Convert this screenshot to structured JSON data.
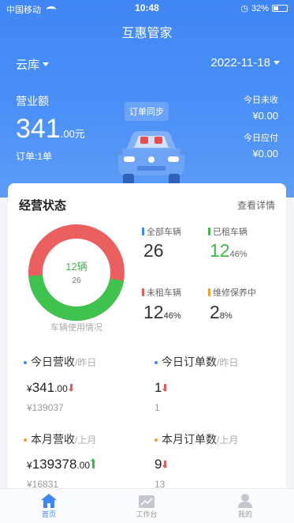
{
  "status_bar": {
    "carrier": "中国移动",
    "time": "10:48",
    "battery": "32%"
  },
  "header": {
    "title": "互惠管家",
    "store": "云库",
    "date": "2022-11-18"
  },
  "revenue": {
    "label": "营业额",
    "value_int": "341",
    "value_dec": ".00元",
    "orders": "订单:1单",
    "sync_button": "订单同步",
    "today_receivable_label": "今日未收",
    "today_receivable_value": "¥0.00",
    "today_payable_label": "今日应付",
    "today_payable_value": "¥0.00"
  },
  "operation": {
    "title": "经营状态",
    "detail_link": "查看详情",
    "donut": {
      "main_text": "12辆",
      "sub_text": "26",
      "caption": "车辆使用情况",
      "rented_fraction": 0.46,
      "colors": {
        "rented": "#3fc34f",
        "unrented": "#eb5f5f"
      }
    },
    "stats": [
      {
        "label": "全部车辆",
        "value": "26",
        "pct": "",
        "color": "#3f86f5"
      },
      {
        "label": "已租车辆",
        "value": "12",
        "pct": "46%",
        "color": "#3bb94a"
      },
      {
        "label": "未租车辆",
        "value": "12",
        "pct": "46%",
        "color": "#e35b5b"
      },
      {
        "label": "维修保养中",
        "value": "2",
        "pct": "8%",
        "color": "#f0a030"
      }
    ]
  },
  "kpis": [
    {
      "label": "今日营收",
      "prev_label": "/昨日",
      "currency": "¥",
      "value_int": "341",
      "value_dec": ".00",
      "trend": "down",
      "prev_value": "¥139037",
      "dot_color": "#3f86f5"
    },
    {
      "label": "今日订单数",
      "prev_label": "/昨日",
      "currency": "",
      "value_int": "1",
      "value_dec": "",
      "trend": "down",
      "prev_value": "1",
      "dot_color": "#3f86f5"
    },
    {
      "label": "本月营收",
      "prev_label": "/上月",
      "currency": "¥",
      "value_int": "139378",
      "value_dec": ".00",
      "trend": "up",
      "prev_value": "¥16831",
      "dot_color": "#f0a030"
    },
    {
      "label": "本月订单数",
      "prev_label": "/上月",
      "currency": "",
      "value_int": "9",
      "value_dec": "",
      "trend": "down",
      "prev_value": "13",
      "dot_color": "#f0a030"
    }
  ],
  "tabbar": [
    {
      "label": "首页",
      "icon": "home-icon",
      "active": true
    },
    {
      "label": "工作台",
      "icon": "chart-icon",
      "active": false
    },
    {
      "label": "我的",
      "icon": "user-icon",
      "active": false
    }
  ]
}
